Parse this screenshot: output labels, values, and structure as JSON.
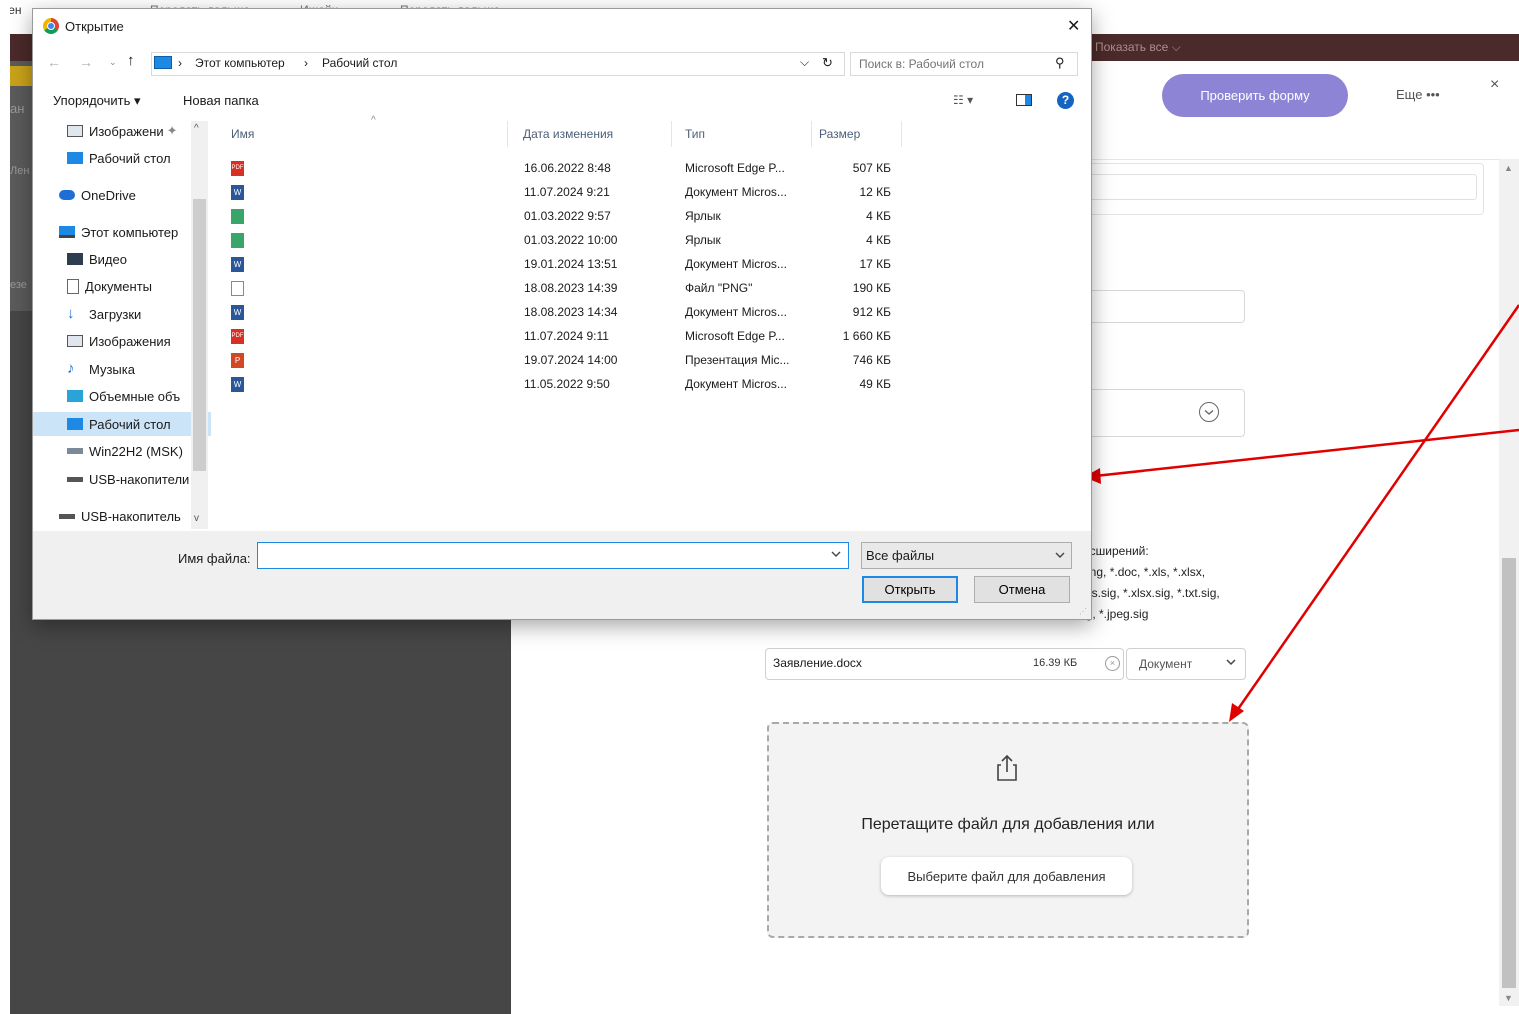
{
  "background": {
    "top_bookmarks": [
      "чен",
      "Передать дальше",
      "Ишейц",
      "Передать дальше"
    ],
    "show_all": "Показать все",
    "check_form_label": "Проверить форму",
    "more_label": "Еще •••",
    "close_label": "×",
    "left_fragments": [
      "ан",
      "Лен",
      "езе"
    ],
    "extensions_text": [
      "асширений:",
      "png, *.doc, *.xls, *.xlsx,",
      "xls.sig, *.xlsx.sig, *.txt.sig,",
      "ig, *.jpeg.sig"
    ],
    "attached_file": {
      "name": "Заявление.docx",
      "size": "16.39 КБ",
      "remove_icon": "circle-x-icon"
    },
    "doc_type_select": "Документ",
    "dropzone_text": "Перетащите файл для добавления или",
    "choose_file_label": "Выберите файл для добавления",
    "annotation_color": "#e00000"
  },
  "dialog": {
    "title": "Открытие",
    "close_label": "✕",
    "breadcrumb": [
      "Этот компьютер",
      "Рабочий стол"
    ],
    "search_placeholder": "Поиск в: Рабочий стол",
    "toolbar": {
      "organize": "Упорядочить",
      "new_folder": "Новая папка"
    },
    "columns": {
      "name": "Имя",
      "date": "Дата изменения",
      "type": "Тип",
      "size": "Размер"
    },
    "nav_items": [
      {
        "label": "Изображени",
        "icon": "pictures-icon",
        "pinned": true
      },
      {
        "label": "Рабочий стол",
        "icon": "desktop-icon"
      },
      {
        "label": "OneDrive",
        "icon": "cloud-icon"
      },
      {
        "label": "Этот компьютер",
        "icon": "computer-icon"
      },
      {
        "label": "Видео",
        "icon": "video-icon"
      },
      {
        "label": "Документы",
        "icon": "documents-icon"
      },
      {
        "label": "Загрузки",
        "icon": "downloads-icon"
      },
      {
        "label": "Изображения",
        "icon": "pictures-icon"
      },
      {
        "label": "Музыка",
        "icon": "music-icon"
      },
      {
        "label": "Объемные объ",
        "icon": "3d-objects-icon"
      },
      {
        "label": "Рабочий стол",
        "icon": "desktop-icon",
        "selected": true
      },
      {
        "label": "Win22H2 (MSK)",
        "icon": "network-drive-icon"
      },
      {
        "label": "USB-накопители",
        "icon": "usb-drive-icon"
      },
      {
        "label": "USB-накопитель",
        "icon": "usb-drive-icon"
      }
    ],
    "files": [
      {
        "icon": "pdf-icon",
        "date": "16.06.2022 8:48",
        "type": "Microsoft Edge P...",
        "size": "507 КБ"
      },
      {
        "icon": "word-icon",
        "date": "11.07.2024 9:21",
        "type": "Документ Micros...",
        "size": "12 КБ"
      },
      {
        "icon": "shortcut-icon",
        "date": "01.03.2022 9:57",
        "type": "Ярлык",
        "size": "4 КБ"
      },
      {
        "icon": "shortcut-icon",
        "date": "01.03.2022 10:00",
        "type": "Ярлык",
        "size": "4 КБ"
      },
      {
        "icon": "word-icon",
        "date": "19.01.2024 13:51",
        "type": "Документ Micros...",
        "size": "17 КБ"
      },
      {
        "icon": "blank-file-icon",
        "date": "18.08.2023 14:39",
        "type": "Файл \"PNG\"",
        "size": "190 КБ"
      },
      {
        "icon": "word-icon",
        "date": "18.08.2023 14:34",
        "type": "Документ Micros...",
        "size": "912 КБ"
      },
      {
        "icon": "pdf-icon",
        "date": "11.07.2024 9:11",
        "type": "Microsoft Edge P...",
        "size": "1 660 КБ"
      },
      {
        "icon": "powerpoint-icon",
        "date": "19.07.2024 14:00",
        "type": "Презентация Mic...",
        "size": "746 КБ"
      },
      {
        "icon": "word-icon",
        "date": "11.05.2022 9:50",
        "type": "Документ Micros...",
        "size": "49 КБ"
      }
    ],
    "filename_label": "Имя файла:",
    "filename_value": "",
    "filetype_select": "Все файлы",
    "open_label": "Открыть",
    "cancel_label": "Отмена"
  }
}
